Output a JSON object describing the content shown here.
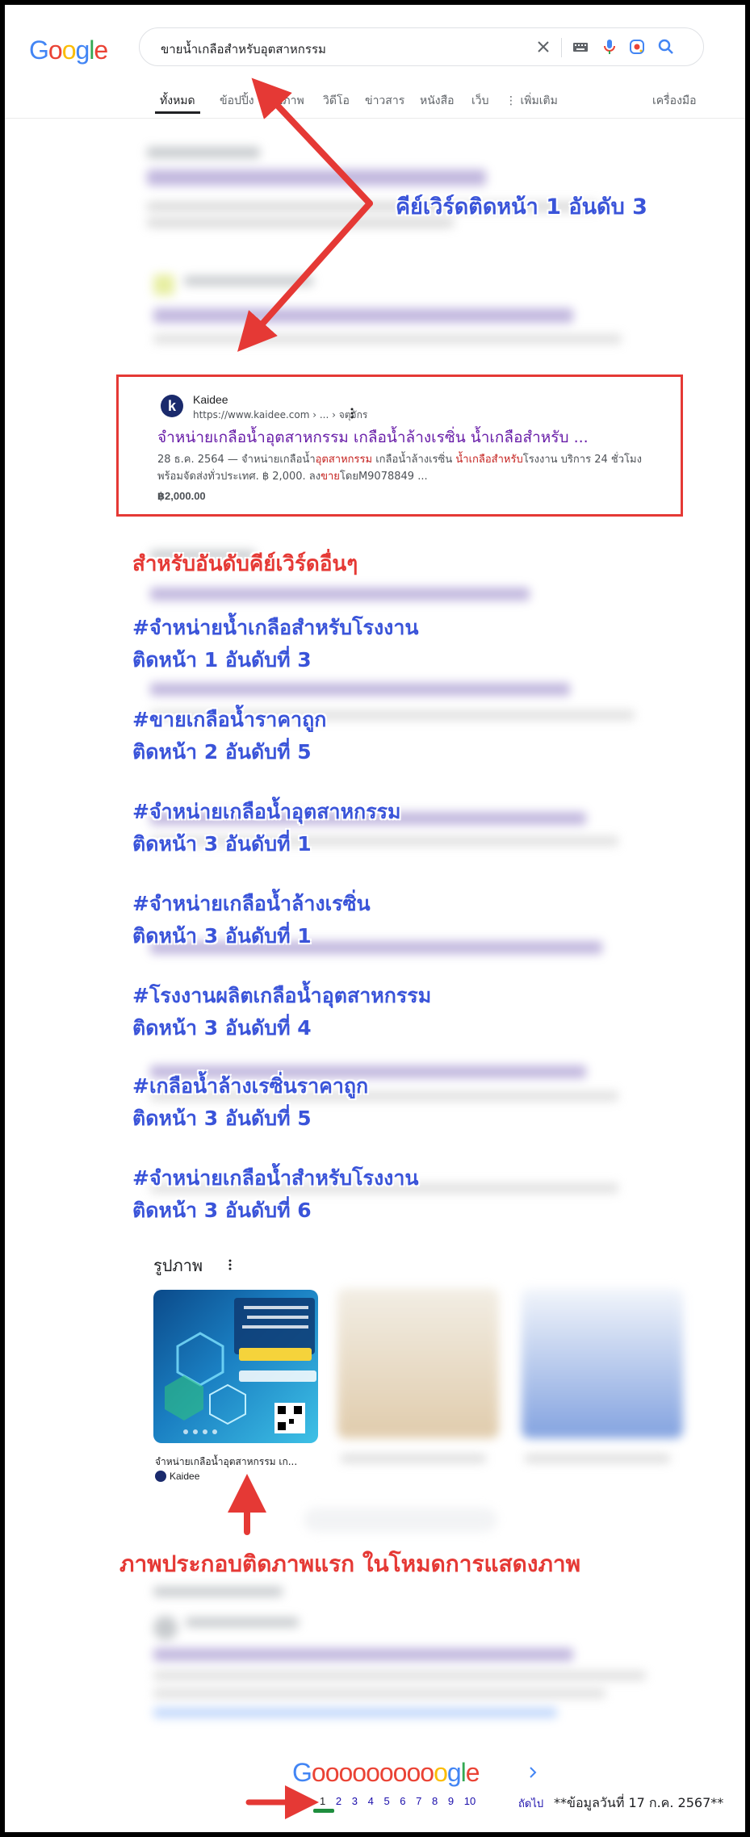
{
  "search": {
    "query": "ขายน้ำเกลือสำหรับอุตสาหกรรม"
  },
  "logo": {
    "letters": [
      "G",
      "o",
      "o",
      "g",
      "l",
      "e"
    ],
    "colors": [
      "#4285f4",
      "#ea4335",
      "#fbbc05",
      "#4285f4",
      "#34a853",
      "#ea4335"
    ]
  },
  "tabs": [
    {
      "label": "ทั้งหมด"
    },
    {
      "label": "ข้อปปิ้ง"
    },
    {
      "label": "รูปภาพ"
    },
    {
      "label": "วิดีโอ"
    },
    {
      "label": "ข่าวสาร"
    },
    {
      "label": "หนังสือ"
    },
    {
      "label": "เว็บ"
    },
    {
      "label": "⋮ เพิ่มเติม"
    }
  ],
  "tools_label": "เครื่องมือ",
  "result": {
    "site_name": "Kaidee",
    "favicon_letter": "k",
    "url": "https://www.kaidee.com › ... › จตุจักร",
    "title": "จำหน่ายเกลือน้ำอุตสาหกรรม เกลือน้ำล้างเรซิ่น น้ำเกลือสำหรับ ...",
    "snippet_parts": [
      "28 ธ.ค. 2564 — จำหน่ายเกลือน้ำ",
      "อุตสาหกรรม",
      " เกลือน้ำล้างเรซิ่น ",
      "น้ำเกลือสำหรับ",
      "โรงงาน บริการ 24 ชั่วโมง พร้อมจัดส่งทั่วประเทศ. ฿ 2,000. ลง",
      "ขาย",
      "โดยM9078849 ..."
    ],
    "price": "฿2,000.00"
  },
  "annotations": {
    "headline": "คีย์เวิร์ดติดหน้า 1 อันดับ 3",
    "other_rank": "สำหรับอันดับคีย์เวิร์ดอื่นๆ",
    "image_note": "ภาพประกอบติดภาพแรก ในโหมดการแสดงภาพ"
  },
  "keywords": [
    {
      "keyword": "#จำหน่ายน้ำเกลือสำหรับโรงงาน",
      "rank": "ติดหน้า 1 อันดับที่ 3"
    },
    {
      "keyword": "#ขายเกลือน้ำราคาถูก",
      "rank": "ติดหน้า 2 อันดับที่ 5"
    },
    {
      "keyword": "#จำหน่ายเกลือน้ำอุตสาหกรรม",
      "rank": "ติดหน้า 3 อันดับที่ 1"
    },
    {
      "keyword": "#จำหน่ายเกลือน้ำล้างเรซิ่น",
      "rank": "ติดหน้า 3 อันดับที่ 1"
    },
    {
      "keyword": "#โรงงานผลิตเกลือน้ำอุตสาหกรรม",
      "rank": "ติดหน้า 3 อันดับที่ 4"
    },
    {
      "keyword": "#เกลือน้ำล้างเรซิ่นราคาถูก",
      "rank": "ติดหน้า 3 อันดับที่ 5"
    },
    {
      "keyword": "#จำหน่ายเกลือน้ำสำหรับโรงงาน",
      "rank": "ติดหน้า 3 อันดับที่ 6"
    }
  ],
  "images_section": {
    "heading": "รูปภาพ",
    "first_caption": "จำหน่ายเกลือน้ำอุตสาหกรรม เก...",
    "first_source": "Kaidee"
  },
  "pagination": {
    "logo_text": "Goooooooooogle",
    "pages": [
      "1",
      "2",
      "3",
      "4",
      "5",
      "6",
      "7",
      "8",
      "9",
      "10"
    ],
    "current": "1",
    "next_label": "ถัดไป"
  },
  "footnote": "**ข้อมูลวันที่ 17 ก.ค. 2567**",
  "colors": {
    "annotation_blue": "#3a54d9",
    "annotation_red": "#e53935",
    "visited_link": "#681da8",
    "highlight_red": "#c5221f"
  }
}
